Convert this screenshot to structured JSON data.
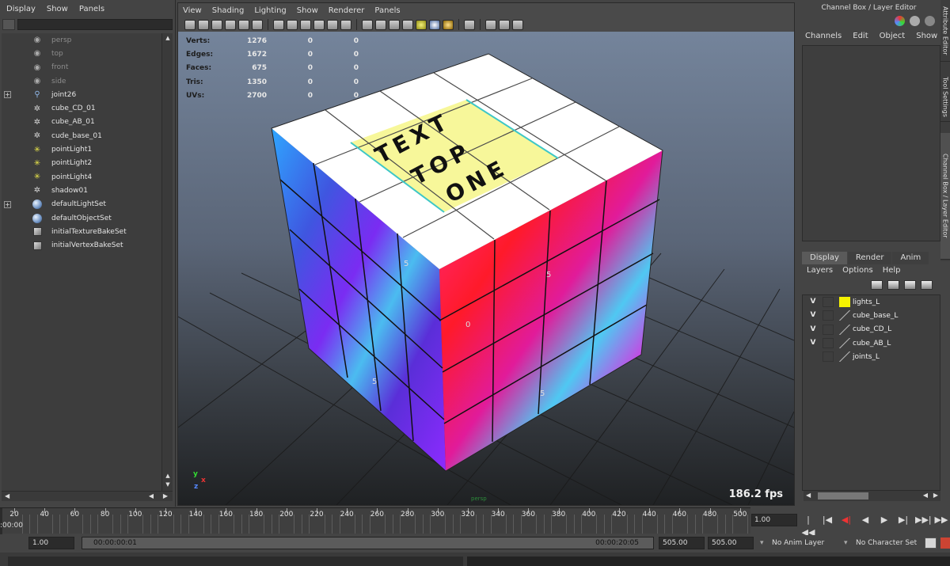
{
  "outliner": {
    "menu": [
      "Display",
      "Show",
      "Panels"
    ],
    "items": [
      {
        "label": "persp",
        "icon": "camera-icon",
        "dim": true,
        "expand": false
      },
      {
        "label": "top",
        "icon": "camera-icon",
        "dim": true,
        "expand": false
      },
      {
        "label": "front",
        "icon": "camera-icon",
        "dim": true,
        "expand": false
      },
      {
        "label": "side",
        "icon": "camera-icon",
        "dim": true,
        "expand": false
      },
      {
        "label": "joint26",
        "icon": "joint-icon",
        "dim": false,
        "expand": true
      },
      {
        "label": "cube_CD_01",
        "icon": "mesh-icon",
        "dim": false,
        "expand": false
      },
      {
        "label": "cube_AB_01",
        "icon": "mesh-icon",
        "dim": false,
        "expand": false
      },
      {
        "label": "cude_base_01",
        "icon": "mesh-icon",
        "dim": false,
        "expand": false
      },
      {
        "label": "pointLight1",
        "icon": "light-icon",
        "dim": false,
        "expand": false
      },
      {
        "label": "pointLight2",
        "icon": "light-icon",
        "dim": false,
        "expand": false
      },
      {
        "label": "pointLight4",
        "icon": "light-icon",
        "dim": false,
        "expand": false
      },
      {
        "label": "shadow01",
        "icon": "mesh-icon",
        "dim": false,
        "expand": false
      },
      {
        "label": "defaultLightSet",
        "icon": "set-icon",
        "dim": false,
        "expand": true
      },
      {
        "label": "defaultObjectSet",
        "icon": "set-icon",
        "dim": false,
        "expand": false
      },
      {
        "label": "initialTextureBakeSet",
        "icon": "bake-icon",
        "dim": false,
        "expand": false
      },
      {
        "label": "initialVertexBakeSet",
        "icon": "bake-icon",
        "dim": false,
        "expand": false
      }
    ]
  },
  "viewport": {
    "menu": [
      "View",
      "Shading",
      "Lighting",
      "Show",
      "Renderer",
      "Panels"
    ],
    "hud": [
      {
        "label": "Verts:",
        "v1": "1276",
        "v2": "0",
        "v3": "0"
      },
      {
        "label": "Edges:",
        "v1": "1672",
        "v2": "0",
        "v3": "0"
      },
      {
        "label": "Faces:",
        "v1": "675",
        "v2": "0",
        "v3": "0"
      },
      {
        "label": "Tris:",
        "v1": "1350",
        "v2": "0",
        "v3": "0"
      },
      {
        "label": "UVs:",
        "v1": "2700",
        "v2": "0",
        "v3": "0"
      }
    ],
    "fps": "186.2 fps",
    "camera_label": "persp",
    "top_text": [
      "TEXT",
      "TOP",
      "ONE"
    ],
    "face_numbers": [
      "5",
      "5",
      "0",
      "5",
      "5"
    ],
    "axis": {
      "x": "x",
      "y": "y",
      "z": "z"
    }
  },
  "channel_box": {
    "title": "Channel Box / Layer Editor",
    "menu": [
      "Channels",
      "Edit",
      "Object",
      "Show"
    ]
  },
  "side_tabs": [
    "Attribute Editor",
    "Tool Settings",
    "Channel Box / Layer Editor"
  ],
  "layer_editor": {
    "tabs": [
      "Display",
      "Render",
      "Anim"
    ],
    "active_tab": "Display",
    "menu": [
      "Layers",
      "Options",
      "Help"
    ],
    "layers": [
      {
        "vis": "V",
        "name": "lights_L",
        "color": "#f5f200"
      },
      {
        "vis": "V",
        "name": "cube_base_L",
        "color": ""
      },
      {
        "vis": "V",
        "name": "cube_CD_L",
        "color": ""
      },
      {
        "vis": "V",
        "name": "cube_AB_L",
        "color": ""
      },
      {
        "vis": "",
        "name": "joints_L",
        "color": ""
      }
    ]
  },
  "timeline": {
    "labels": [
      "20",
      "40",
      "60",
      "80",
      "100",
      "120",
      "140",
      "160",
      "180",
      "200",
      "220",
      "240",
      "260",
      "280",
      "300",
      "320",
      "340",
      "360",
      "380",
      "400",
      "420",
      "440",
      "460",
      "480",
      "500"
    ],
    "current_left": ":00:00",
    "current_frame": "1.00",
    "playback": [
      "|◀◀",
      "|◀",
      "◀|",
      "◀",
      "▶",
      "▶|",
      "▶▶|",
      "▶▶"
    ]
  },
  "range": {
    "start_field": "1.00",
    "start_time": "00:00:00:01",
    "end_time": "00:00:20:05",
    "end_field_1": "505.00",
    "end_field_2": "505.00",
    "anim_layer": "No Anim Layer",
    "char_set": "No Character Set"
  },
  "colors": {
    "layer_yellow": "#f5f200",
    "hud_green": "#2c8d3b"
  }
}
